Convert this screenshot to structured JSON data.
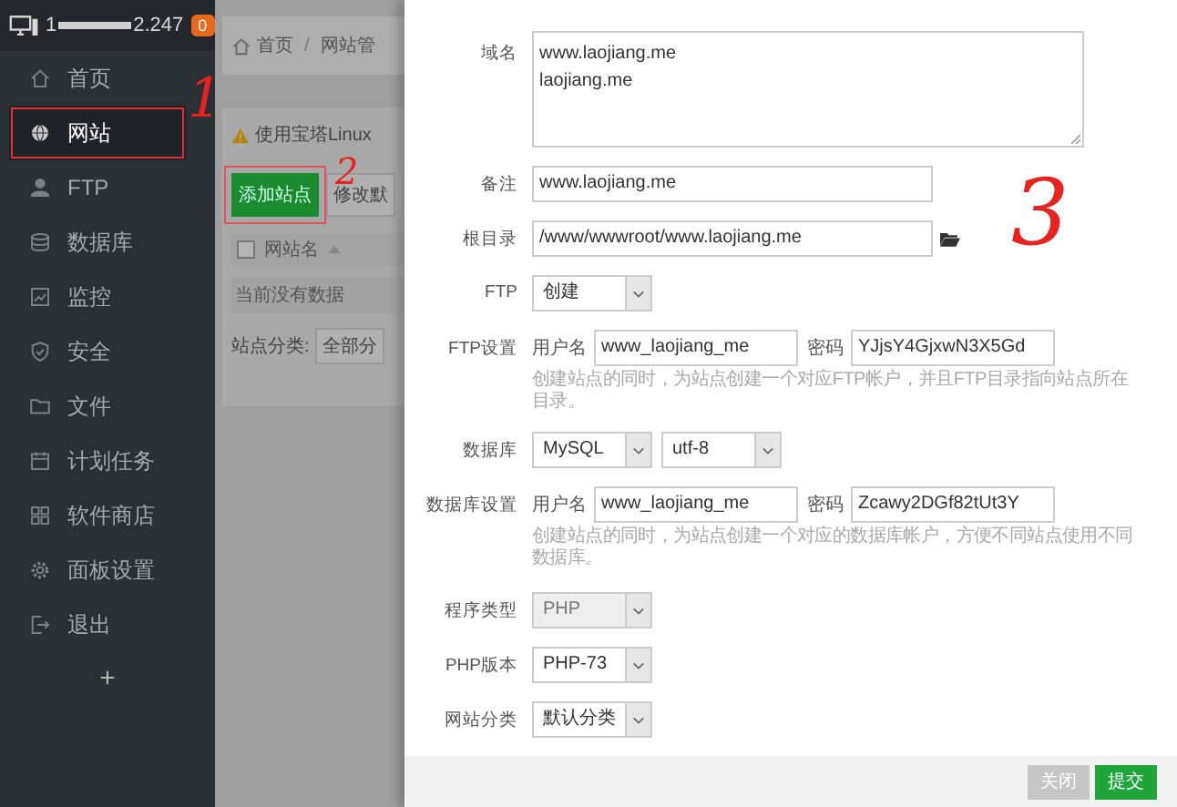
{
  "sidebar": {
    "ip_prefix": "1",
    "ip_suffix": "2.247",
    "badge": "0",
    "items": [
      {
        "label": "首页",
        "selected": false,
        "highlighted": false
      },
      {
        "label": "网站",
        "selected": true,
        "highlighted": true
      },
      {
        "label": "FTP",
        "selected": false,
        "highlighted": false
      },
      {
        "label": "数据库",
        "selected": false,
        "highlighted": false
      },
      {
        "label": "监控",
        "selected": false,
        "highlighted": false
      },
      {
        "label": "安全",
        "selected": false,
        "highlighted": false
      },
      {
        "label": "文件",
        "selected": false,
        "highlighted": false
      },
      {
        "label": "计划任务",
        "selected": false,
        "highlighted": false
      },
      {
        "label": "软件商店",
        "selected": false,
        "highlighted": false
      },
      {
        "label": "面板设置",
        "selected": false,
        "highlighted": false
      },
      {
        "label": "退出",
        "selected": false,
        "highlighted": false
      }
    ],
    "add": "+"
  },
  "background": {
    "breadcrumb": [
      "首页",
      "网站管"
    ],
    "separator": "/",
    "warning": "使用宝塔Linux",
    "buttons": [
      {
        "label": "添加站点",
        "kind": "primary",
        "highlighted": true
      },
      {
        "label": "修改默",
        "kind": "default",
        "highlighted": false
      }
    ],
    "table": {
      "checked": false,
      "columns": [
        "网站名"
      ],
      "empty": "当前没有数据"
    },
    "category_label": "站点分类:",
    "category_value": "全部分"
  },
  "form": {
    "rows": [
      {
        "kind": "textarea",
        "label": "域名",
        "lines": [
          "www.laojiang.me",
          "laojiang.me"
        ]
      },
      {
        "kind": "input",
        "label": "备注",
        "value": "www.laojiang.me"
      },
      {
        "kind": "path",
        "label": "根目录",
        "value": "/www/wwwroot/www.laojiang.me"
      },
      {
        "kind": "selects",
        "label": "FTP",
        "selects": [
          {
            "value": "创建",
            "disabled": false
          }
        ]
      },
      {
        "kind": "credentials",
        "label": "FTP设置",
        "user_label": "用户名",
        "user": "www_laojiang_me",
        "pass_label": "密码",
        "pass": "YJjsY4GjxwN3X5Gd",
        "hint": "创建站点的同时，为站点创建一个对应FTP帐户，并且FTP目录指向站点所在目录。"
      },
      {
        "kind": "selects",
        "label": "数据库",
        "selects": [
          {
            "value": "MySQL",
            "disabled": false
          },
          {
            "value": "utf-8",
            "disabled": false
          }
        ]
      },
      {
        "kind": "credentials",
        "label": "数据库设置",
        "user_label": "用户名",
        "user": "www_laojiang_me",
        "pass_label": "密码",
        "pass": "Zcawy2DGf82tUt3Y",
        "hint": "创建站点的同时，为站点创建一个对应的数据库帐户，方便不同站点使用不同数据库。"
      },
      {
        "kind": "selects",
        "label": "程序类型",
        "selects": [
          {
            "value": "PHP",
            "disabled": true
          }
        ]
      },
      {
        "kind": "selects",
        "label": "PHP版本",
        "selects": [
          {
            "value": "PHP-73",
            "disabled": false
          }
        ]
      },
      {
        "kind": "selects",
        "label": "网站分类",
        "selects": [
          {
            "value": "默认分类",
            "disabled": false
          }
        ]
      }
    ],
    "buttons": [
      {
        "label": "关闭",
        "kind": "default"
      },
      {
        "label": "提交",
        "kind": "primary"
      }
    ]
  },
  "annotations": [
    {
      "label": "1"
    },
    {
      "label": "2"
    },
    {
      "label": "3"
    }
  ]
}
